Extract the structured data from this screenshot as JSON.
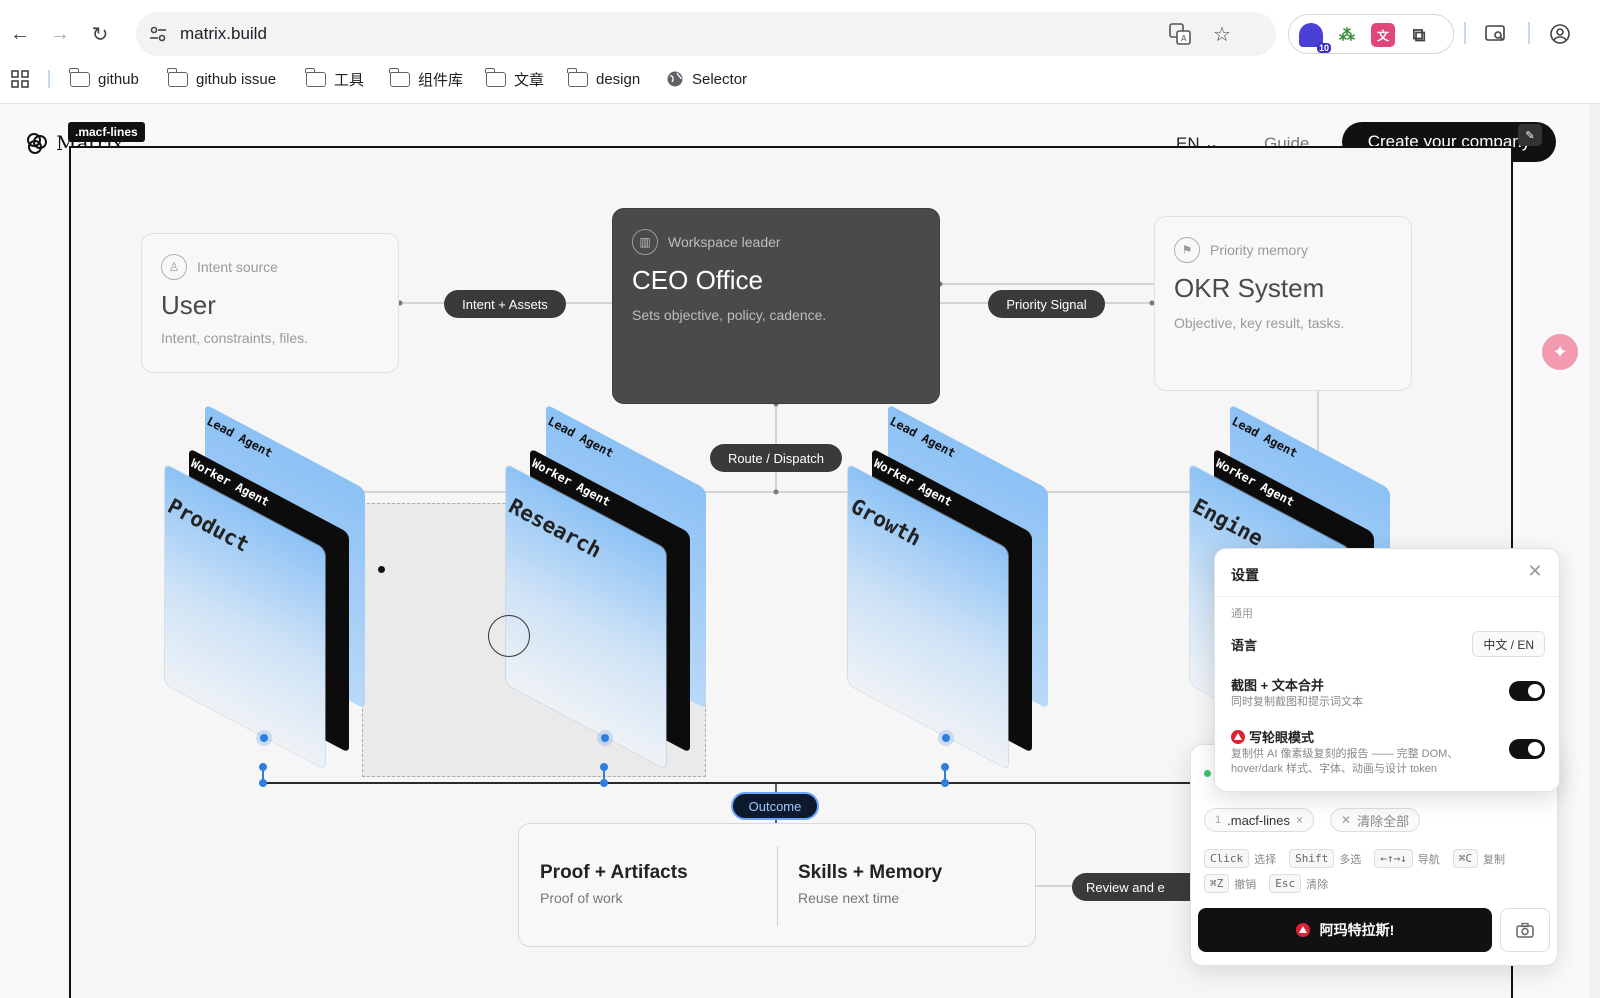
{
  "browser": {
    "url": "matrix.build",
    "ext_badge": "10",
    "bookmarks": [
      "github",
      "github issue",
      "工具",
      "组件库",
      "文章",
      "design",
      "Selector"
    ]
  },
  "header": {
    "logo": "Matrix",
    "tag_badge": ".macf-lines",
    "lang": "EN",
    "guide": "Guide",
    "cta": "Create your company"
  },
  "cards": {
    "user": {
      "kicker": "Intent source",
      "title": "User",
      "sub": "Intent, constraints, files."
    },
    "ceo": {
      "kicker": "Workspace leader",
      "title": "CEO Office",
      "sub": "Sets objective, policy, cadence."
    },
    "okr": {
      "kicker": "Priority memory",
      "title": "OKR System",
      "sub": "Objective, key result, tasks."
    }
  },
  "pills": {
    "intent": "Intent + Assets",
    "priority": "Priority Signal",
    "route": "Route / Dispatch",
    "outcome": "Outcome",
    "review": "Review and e"
  },
  "stacks": {
    "lead_label": "Lead Agent",
    "worker_label": "Worker Agent",
    "teams": [
      "Product",
      "Research",
      "Growth",
      "Engine"
    ]
  },
  "outcome_card": {
    "left_title": "Proof + Artifacts",
    "left_sub": "Proof of work",
    "right_title": "Skills + Memory",
    "right_sub": "Reuse next time"
  },
  "settings": {
    "title": "设置",
    "section": "通用",
    "language_label": "语言",
    "language_button": "中文 / EN",
    "merge_label": "截图 + 文本合并",
    "merge_sub": "同时复制截图和提示词文本",
    "merge_on": true,
    "sharingan_label": "写轮眼模式",
    "sharingan_sub": "复制供 AI 像素级复刻的报告 —— 完整 DOM、hover/dark 样式、字体、动画与设计 token",
    "sharingan_on": true
  },
  "selector_panel": {
    "chip_index": "1",
    "chip_label": ".macf-lines",
    "clear_all": "清除全部",
    "shortcuts_row1": [
      {
        "key": "Click",
        "desc": "选择"
      },
      {
        "key": "Shift",
        "desc": "多选"
      },
      {
        "key": "←↑→↓",
        "desc": "导航"
      },
      {
        "key": "⌘C",
        "desc": "复制"
      }
    ],
    "shortcuts_row2": [
      {
        "key": "⌘Z",
        "desc": "撤销"
      },
      {
        "key": "Esc",
        "desc": "清除"
      }
    ],
    "go_button": "阿玛特拉斯!"
  },
  "colors": {
    "accent_blue": "#2f7fe0",
    "dark_card": "#4a4a4d",
    "pill": "#3a3a3c"
  }
}
